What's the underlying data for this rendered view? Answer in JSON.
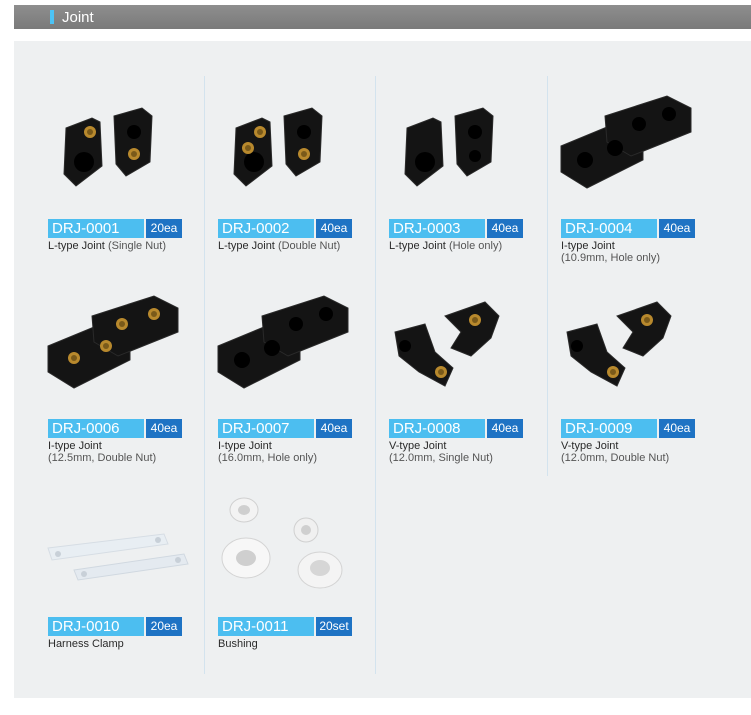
{
  "section": {
    "title": "Joint"
  },
  "products": [
    {
      "code": "DRJ-0001",
      "qty": "20ea",
      "name": "L-type Joint",
      "note": "(Single Nut)",
      "sub": "",
      "kind": "L"
    },
    {
      "code": "DRJ-0002",
      "qty": "40ea",
      "name": "L-type Joint",
      "note": "(Double Nut)",
      "sub": "",
      "kind": "L2"
    },
    {
      "code": "DRJ-0003",
      "qty": "40ea",
      "name": "L-type Joint",
      "note": "(Hole only)",
      "sub": "",
      "kind": "L3"
    },
    {
      "code": "DRJ-0004",
      "qty": "40ea",
      "name": "I-type Joint",
      "note": "",
      "sub": "(10.9mm, Hole only)",
      "kind": "I"
    },
    {
      "code": "DRJ-0006",
      "qty": "40ea",
      "name": "I-type Joint",
      "note": "",
      "sub": "(12.5mm, Double Nut)",
      "kind": "I2"
    },
    {
      "code": "DRJ-0007",
      "qty": "40ea",
      "name": "I-type Joint",
      "note": "",
      "sub": "(16.0mm, Hole only)",
      "kind": "I3"
    },
    {
      "code": "DRJ-0008",
      "qty": "40ea",
      "name": "V-type Joint",
      "note": "",
      "sub": "(12.0mm, Single Nut)",
      "kind": "V"
    },
    {
      "code": "DRJ-0009",
      "qty": "40ea",
      "name": "V-type Joint",
      "note": "",
      "sub": "(12.0mm, Double Nut)",
      "kind": "V"
    },
    {
      "code": "DRJ-0010",
      "qty": "20ea",
      "name": "Harness Clamp",
      "note": "",
      "sub": "",
      "kind": "clamp"
    },
    {
      "code": "DRJ-0011",
      "qty": "20set",
      "name": "Bushing",
      "note": "",
      "sub": "",
      "kind": "bush"
    }
  ]
}
